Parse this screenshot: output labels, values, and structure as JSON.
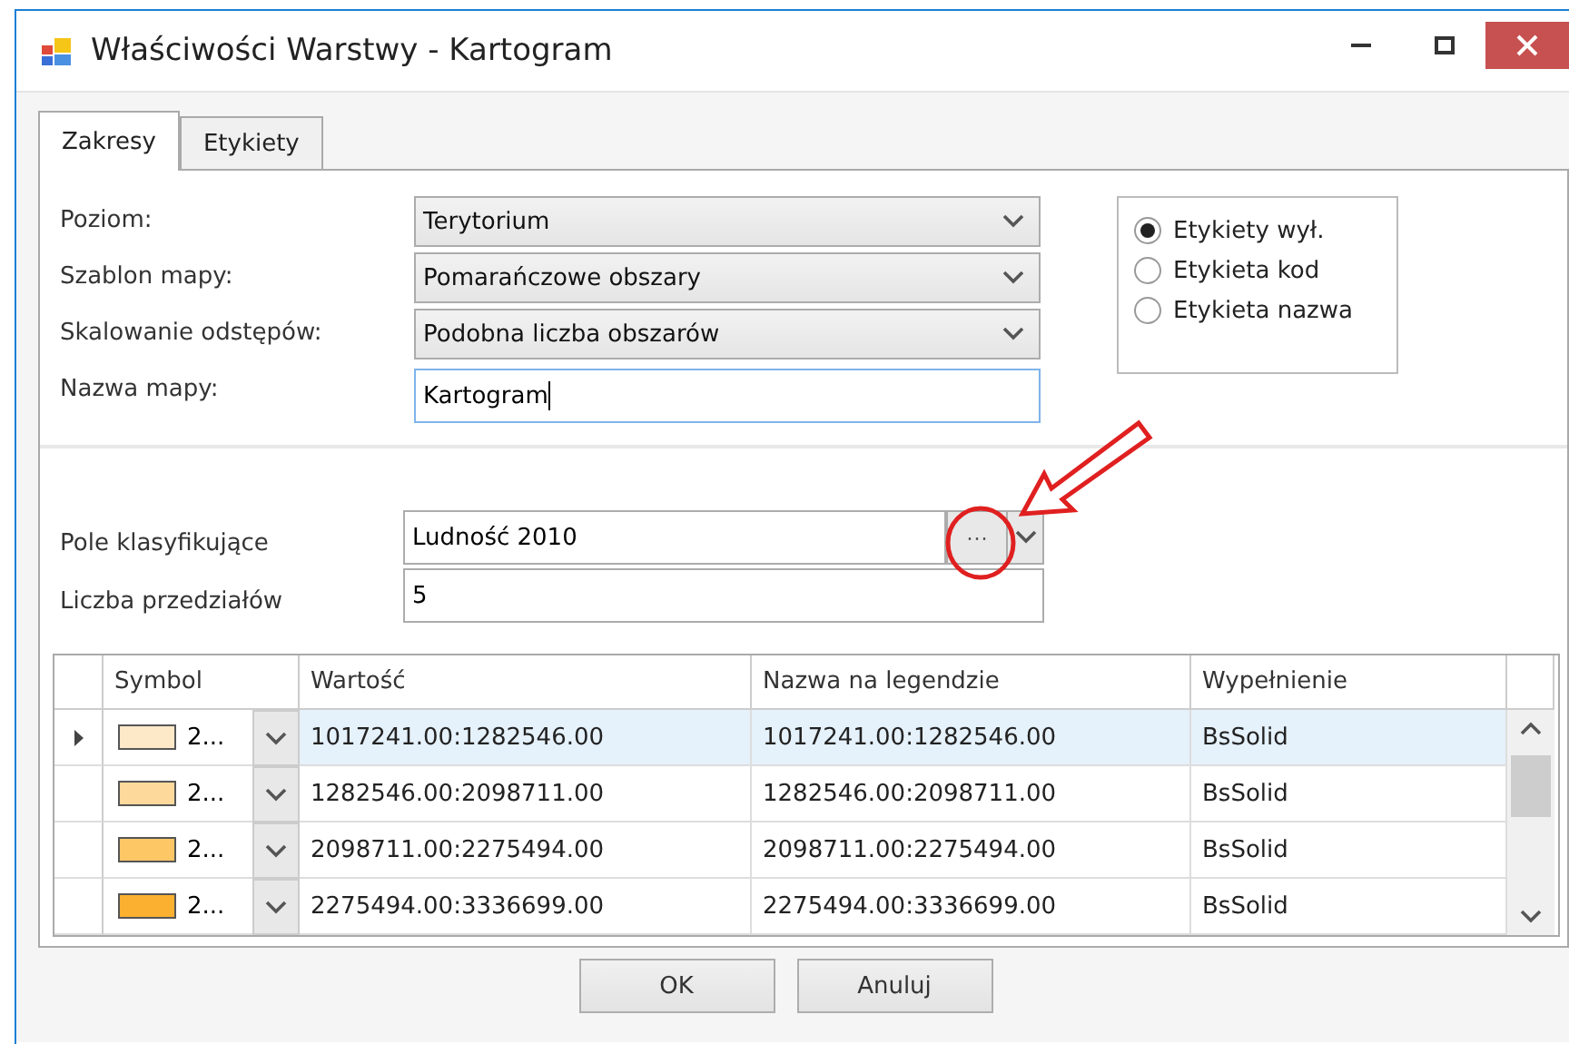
{
  "window": {
    "title": "Właściwości Warstwy - Kartogram"
  },
  "tabs": [
    {
      "label": "Zakresy",
      "selected": true
    },
    {
      "label": "Etykiety",
      "selected": false
    }
  ],
  "form": [
    {
      "label": "Poziom:",
      "kind": "combo",
      "value": "Terytorium"
    },
    {
      "label": "Szablon mapy:",
      "kind": "combo",
      "value": "Pomarańczowe obszary"
    },
    {
      "label": "Skalowanie odstępów:",
      "kind": "combo",
      "value": "Podobna liczba obszarów"
    },
    {
      "label": "Nazwa mapy:",
      "kind": "text",
      "value": "Kartogram"
    }
  ],
  "label_options": [
    {
      "label": "Etykiety wył.",
      "selected": true
    },
    {
      "label": "Etykieta kod",
      "selected": false
    },
    {
      "label": "Etykieta nazwa",
      "selected": false
    }
  ],
  "classification_field": {
    "label": "Pole klasyfikujące",
    "value": "Ludność 2010",
    "browse": "···"
  },
  "interval_count": {
    "label": "Liczba przedziałów",
    "value": "5"
  },
  "table": {
    "columns": [
      "Symbol",
      "Wartość",
      "Nazwa na legendzie",
      "Wypełnienie"
    ],
    "rows": [
      {
        "selected": true,
        "color": "#fde8c8",
        "symbol": "2...",
        "value": "1017241.00:1282546.00",
        "legend": "1017241.00:1282546.00",
        "fill": "BsSolid"
      },
      {
        "selected": false,
        "color": "#fdd99b",
        "symbol": "2...",
        "value": "1282546.00:2098711.00",
        "legend": "1282546.00:2098711.00",
        "fill": "BsSolid"
      },
      {
        "selected": false,
        "color": "#fdc766",
        "symbol": "2...",
        "value": "2098711.00:2275494.00",
        "legend": "2098711.00:2275494.00",
        "fill": "BsSolid"
      },
      {
        "selected": false,
        "color": "#fbb030",
        "symbol": "2...",
        "value": "2275494.00:3336699.00",
        "legend": "2275494.00:3336699.00",
        "fill": "BsSolid"
      }
    ]
  },
  "buttons": [
    "OK",
    "Anuluj"
  ]
}
